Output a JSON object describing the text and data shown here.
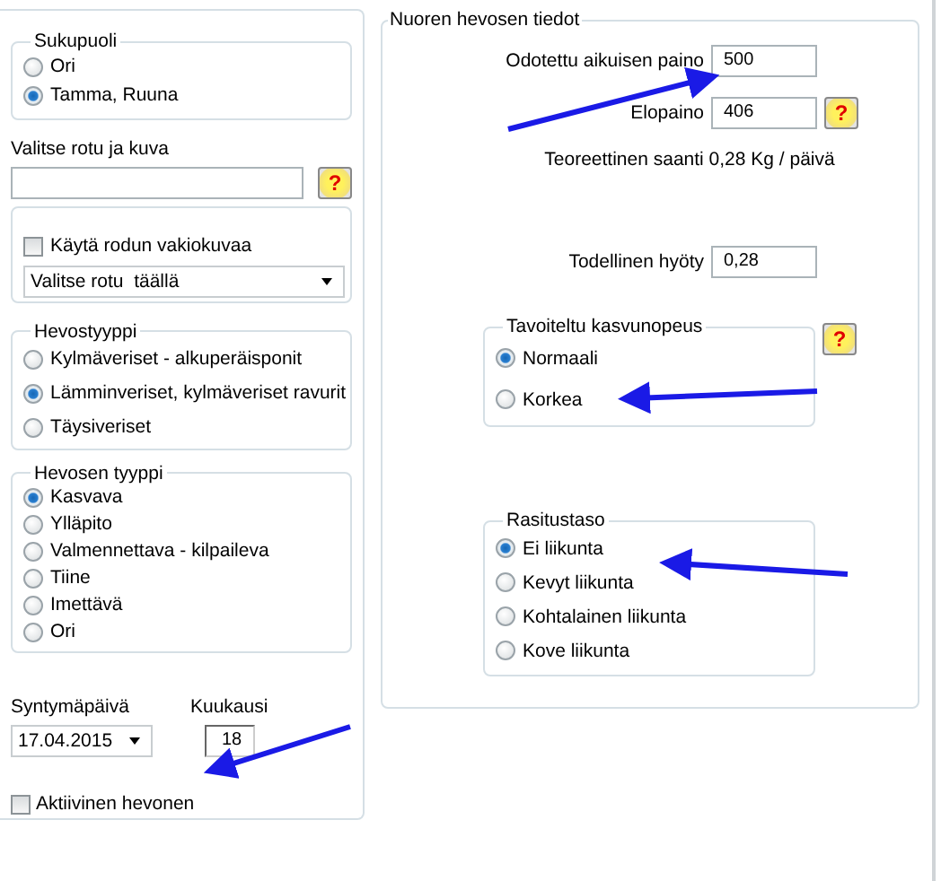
{
  "left_panel": {
    "gender": {
      "title": "Sukupuoli",
      "options": [
        {
          "label": "Ori",
          "selected": false
        },
        {
          "label": "Tamma, Ruuna",
          "selected": true
        }
      ]
    },
    "breed": {
      "label": "Valitse rotu ja kuva",
      "help": "?",
      "default_image": {
        "label": "Käytä rodun vakiokuvaa",
        "checked": false
      },
      "breed_select": {
        "value": "Valitse rotu  täällä"
      }
    },
    "horse_class": {
      "title": "Hevostyyppi",
      "options": [
        {
          "label": "Kylmäveriset - alkuperäisponit",
          "selected": false
        },
        {
          "label": "Lämminveriset, kylmäveriset ravurit",
          "selected": true
        },
        {
          "label": "Täysiveriset",
          "selected": false
        }
      ]
    },
    "horse_type": {
      "title": "Hevosen tyyppi",
      "options": [
        {
          "label": "Kasvava",
          "selected": true
        },
        {
          "label": "Ylläpito",
          "selected": false
        },
        {
          "label": "Valmennettava - kilpaileva",
          "selected": false
        },
        {
          "label": "Tiine",
          "selected": false
        },
        {
          "label": "Imettävä",
          "selected": false
        },
        {
          "label": "Ori",
          "selected": false
        }
      ]
    },
    "birth_date": {
      "label": "Syntymäpäivä",
      "value": "17.04.2015"
    },
    "months": {
      "label": "Kuukausi",
      "value": "18"
    },
    "active": {
      "label": "Aktiivinen hevonen",
      "checked": false
    }
  },
  "right_panel": {
    "title": "Nuoren hevosen tiedot",
    "adult_weight": {
      "label": "Odotettu aikuisen paino",
      "value": "500"
    },
    "live_weight": {
      "label": "Elopaino",
      "value": "406",
      "help": "?"
    },
    "theoretical": "Teoreettinen saanti 0,28 Kg / päivä",
    "actual_gain": {
      "label": "Todellinen hyöty",
      "value": "0,28"
    },
    "growth_rate": {
      "title": "Tavoiteltu kasvunopeus",
      "help": "?",
      "options": [
        {
          "label": "Normaali",
          "selected": true
        },
        {
          "label": "Korkea",
          "selected": false
        }
      ]
    },
    "exercise": {
      "title": "Rasitustaso",
      "options": [
        {
          "label": "Ei liikunta",
          "selected": true
        },
        {
          "label": "Kevyt liikunta",
          "selected": false
        },
        {
          "label": "Kohtalainen liikunta",
          "selected": false
        },
        {
          "label": "Kove liikunta",
          "selected": false
        }
      ]
    }
  }
}
